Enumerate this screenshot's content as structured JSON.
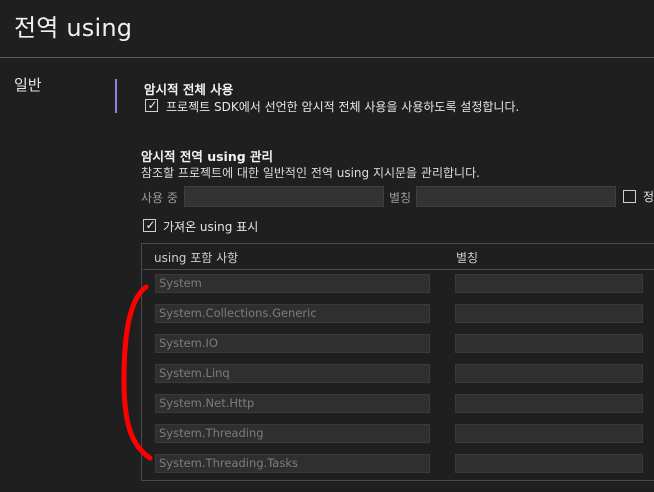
{
  "page": {
    "title": "전역 using"
  },
  "sidebar": {
    "category": "일반"
  },
  "implicit": {
    "heading": "암시적 전체 사용",
    "checkbox_label": "프로젝트 SDK에서 선언한 암시적 전체 사용을 사용하도록 설정합니다.",
    "checked": true
  },
  "manage": {
    "heading": "암시적 전역 using 관리",
    "description": "참조할 프로젝트에 대한 일반적인 전역 using 지시문을 관리합니다.",
    "using_label": "사용 중",
    "alias_label": "별칭",
    "static_label": "정",
    "show_imported_label": "가져온 using 표시",
    "show_imported_checked": true
  },
  "grid": {
    "columns": [
      "using 포함 사항",
      "별칭"
    ],
    "rows": [
      {
        "using": "System",
        "alias": ""
      },
      {
        "using": "System.Collections.Generic",
        "alias": ""
      },
      {
        "using": "System.IO",
        "alias": ""
      },
      {
        "using": "System.Linq",
        "alias": ""
      },
      {
        "using": "System.Net.Http",
        "alias": ""
      },
      {
        "using": "System.Threading",
        "alias": ""
      },
      {
        "using": "System.Threading.Tasks",
        "alias": ""
      }
    ]
  },
  "colors": {
    "background": "#1f1f1f",
    "accent": "#8f7fe0",
    "annotation": "#ff0000"
  }
}
